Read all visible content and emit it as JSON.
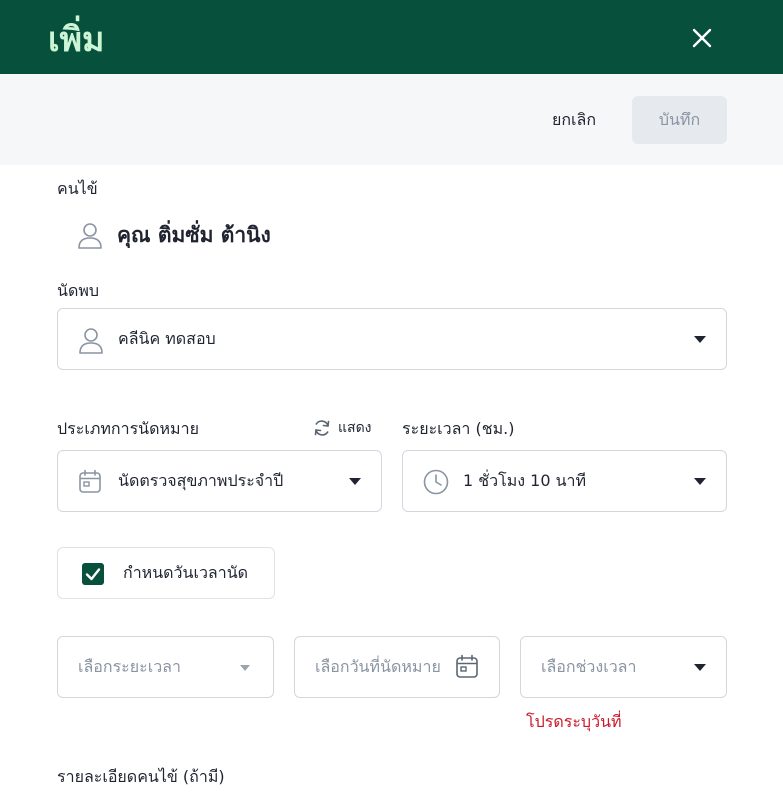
{
  "header": {
    "title": "เพิ่ม",
    "close_icon": "close-icon"
  },
  "actions": {
    "cancel_label": "ยกเลิก",
    "save_label": "บันทึก"
  },
  "patient": {
    "label": "คนไข้",
    "name": "คุณ ติ่มซั่ม ต้านิง",
    "icon": "user-icon"
  },
  "appointment_with": {
    "label": "นัดพบ",
    "value": "คลีนิค ทดสอบ",
    "icon": "user-icon"
  },
  "appointment_type": {
    "label": "ประเภทการนัดหมาย",
    "show_label": "แสดง",
    "value": "นัดตรวจสุขภาพประจำปี",
    "icon": "calendar-icon"
  },
  "duration": {
    "label": "ระยะเวลา (ชม.)",
    "value": "1 ชั่วโมง 10 นาที",
    "icon": "clock-icon"
  },
  "set_datetime": {
    "label": "กำหนดวันเวลานัด",
    "checked": true
  },
  "date_fields": {
    "range_placeholder": "เลือกระยะเวลา",
    "date_placeholder": "เลือกวันที่นัดหมาย",
    "time_placeholder": "เลือกช่วงเวลา",
    "error": "โปรดระบุวันที่"
  },
  "details": {
    "label": "รายละเอียดคนไข้ (ถ้ามี)"
  },
  "colors": {
    "header_bg": "#06503c",
    "title": "#ccf5d6",
    "error": "#c8192a"
  }
}
